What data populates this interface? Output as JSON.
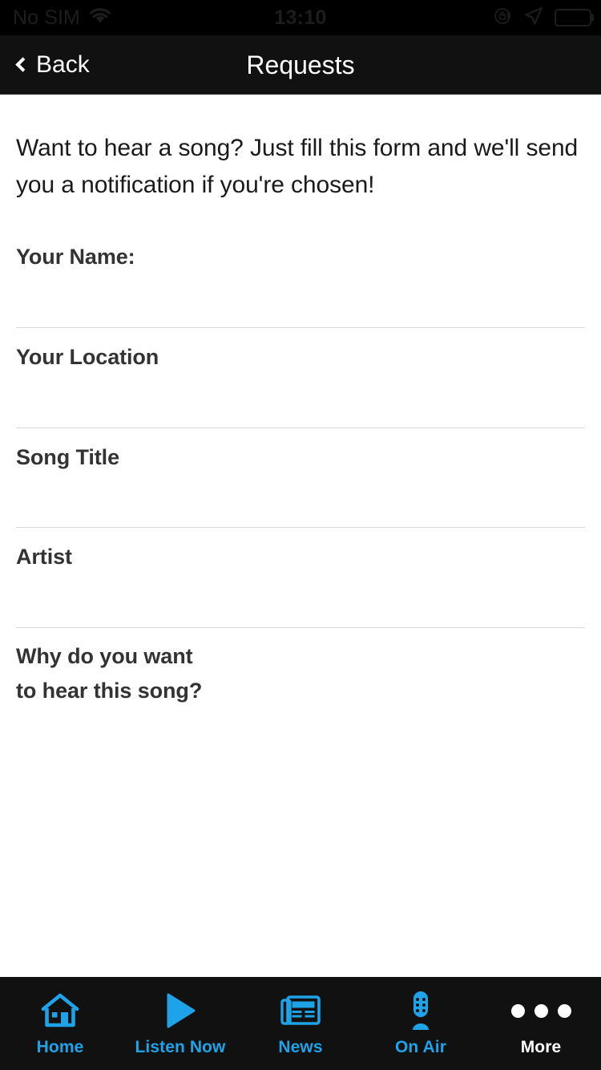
{
  "status_bar": {
    "carrier": "No SIM",
    "time": "13:10",
    "wifi_icon": "wifi-icon",
    "rotation_lock_icon": "rotation-lock-icon",
    "location_icon": "location-arrow-icon",
    "battery_icon": "battery-full-icon"
  },
  "nav_bar": {
    "back_label": "Back",
    "back_icon": "chevron-left-icon",
    "title": "Requests"
  },
  "main": {
    "intro_text": "Want to hear a song? Just fill this form and we'll send you a notification if you're chosen!",
    "fields": [
      {
        "label": "Your Name:",
        "value": "",
        "placeholder": ""
      },
      {
        "label": "Your Location",
        "value": "",
        "placeholder": ""
      },
      {
        "label": "Song Title",
        "value": "",
        "placeholder": ""
      },
      {
        "label": "Artist",
        "value": "",
        "placeholder": ""
      },
      {
        "label": "Why do you want\nto hear this song?",
        "value": "",
        "placeholder": ""
      }
    ]
  },
  "tab_bar": {
    "items": [
      {
        "label": "Home",
        "icon": "home-icon",
        "active": false
      },
      {
        "label": "Listen Now",
        "icon": "play-icon",
        "active": false
      },
      {
        "label": "News",
        "icon": "newspaper-icon",
        "active": false
      },
      {
        "label": "On Air",
        "icon": "microphone-icon",
        "active": false
      },
      {
        "label": "More",
        "icon": "ellipsis-icon",
        "active": true
      }
    ]
  },
  "colors": {
    "accent_blue": "#1FA3E8",
    "bar_background": "#111111",
    "status_background": "#000000",
    "page_background": "#ffffff",
    "label_text": "#333333",
    "body_text": "#1a1a1a",
    "divider": "#d9d9d9",
    "active_tab_text": "#ffffff"
  }
}
